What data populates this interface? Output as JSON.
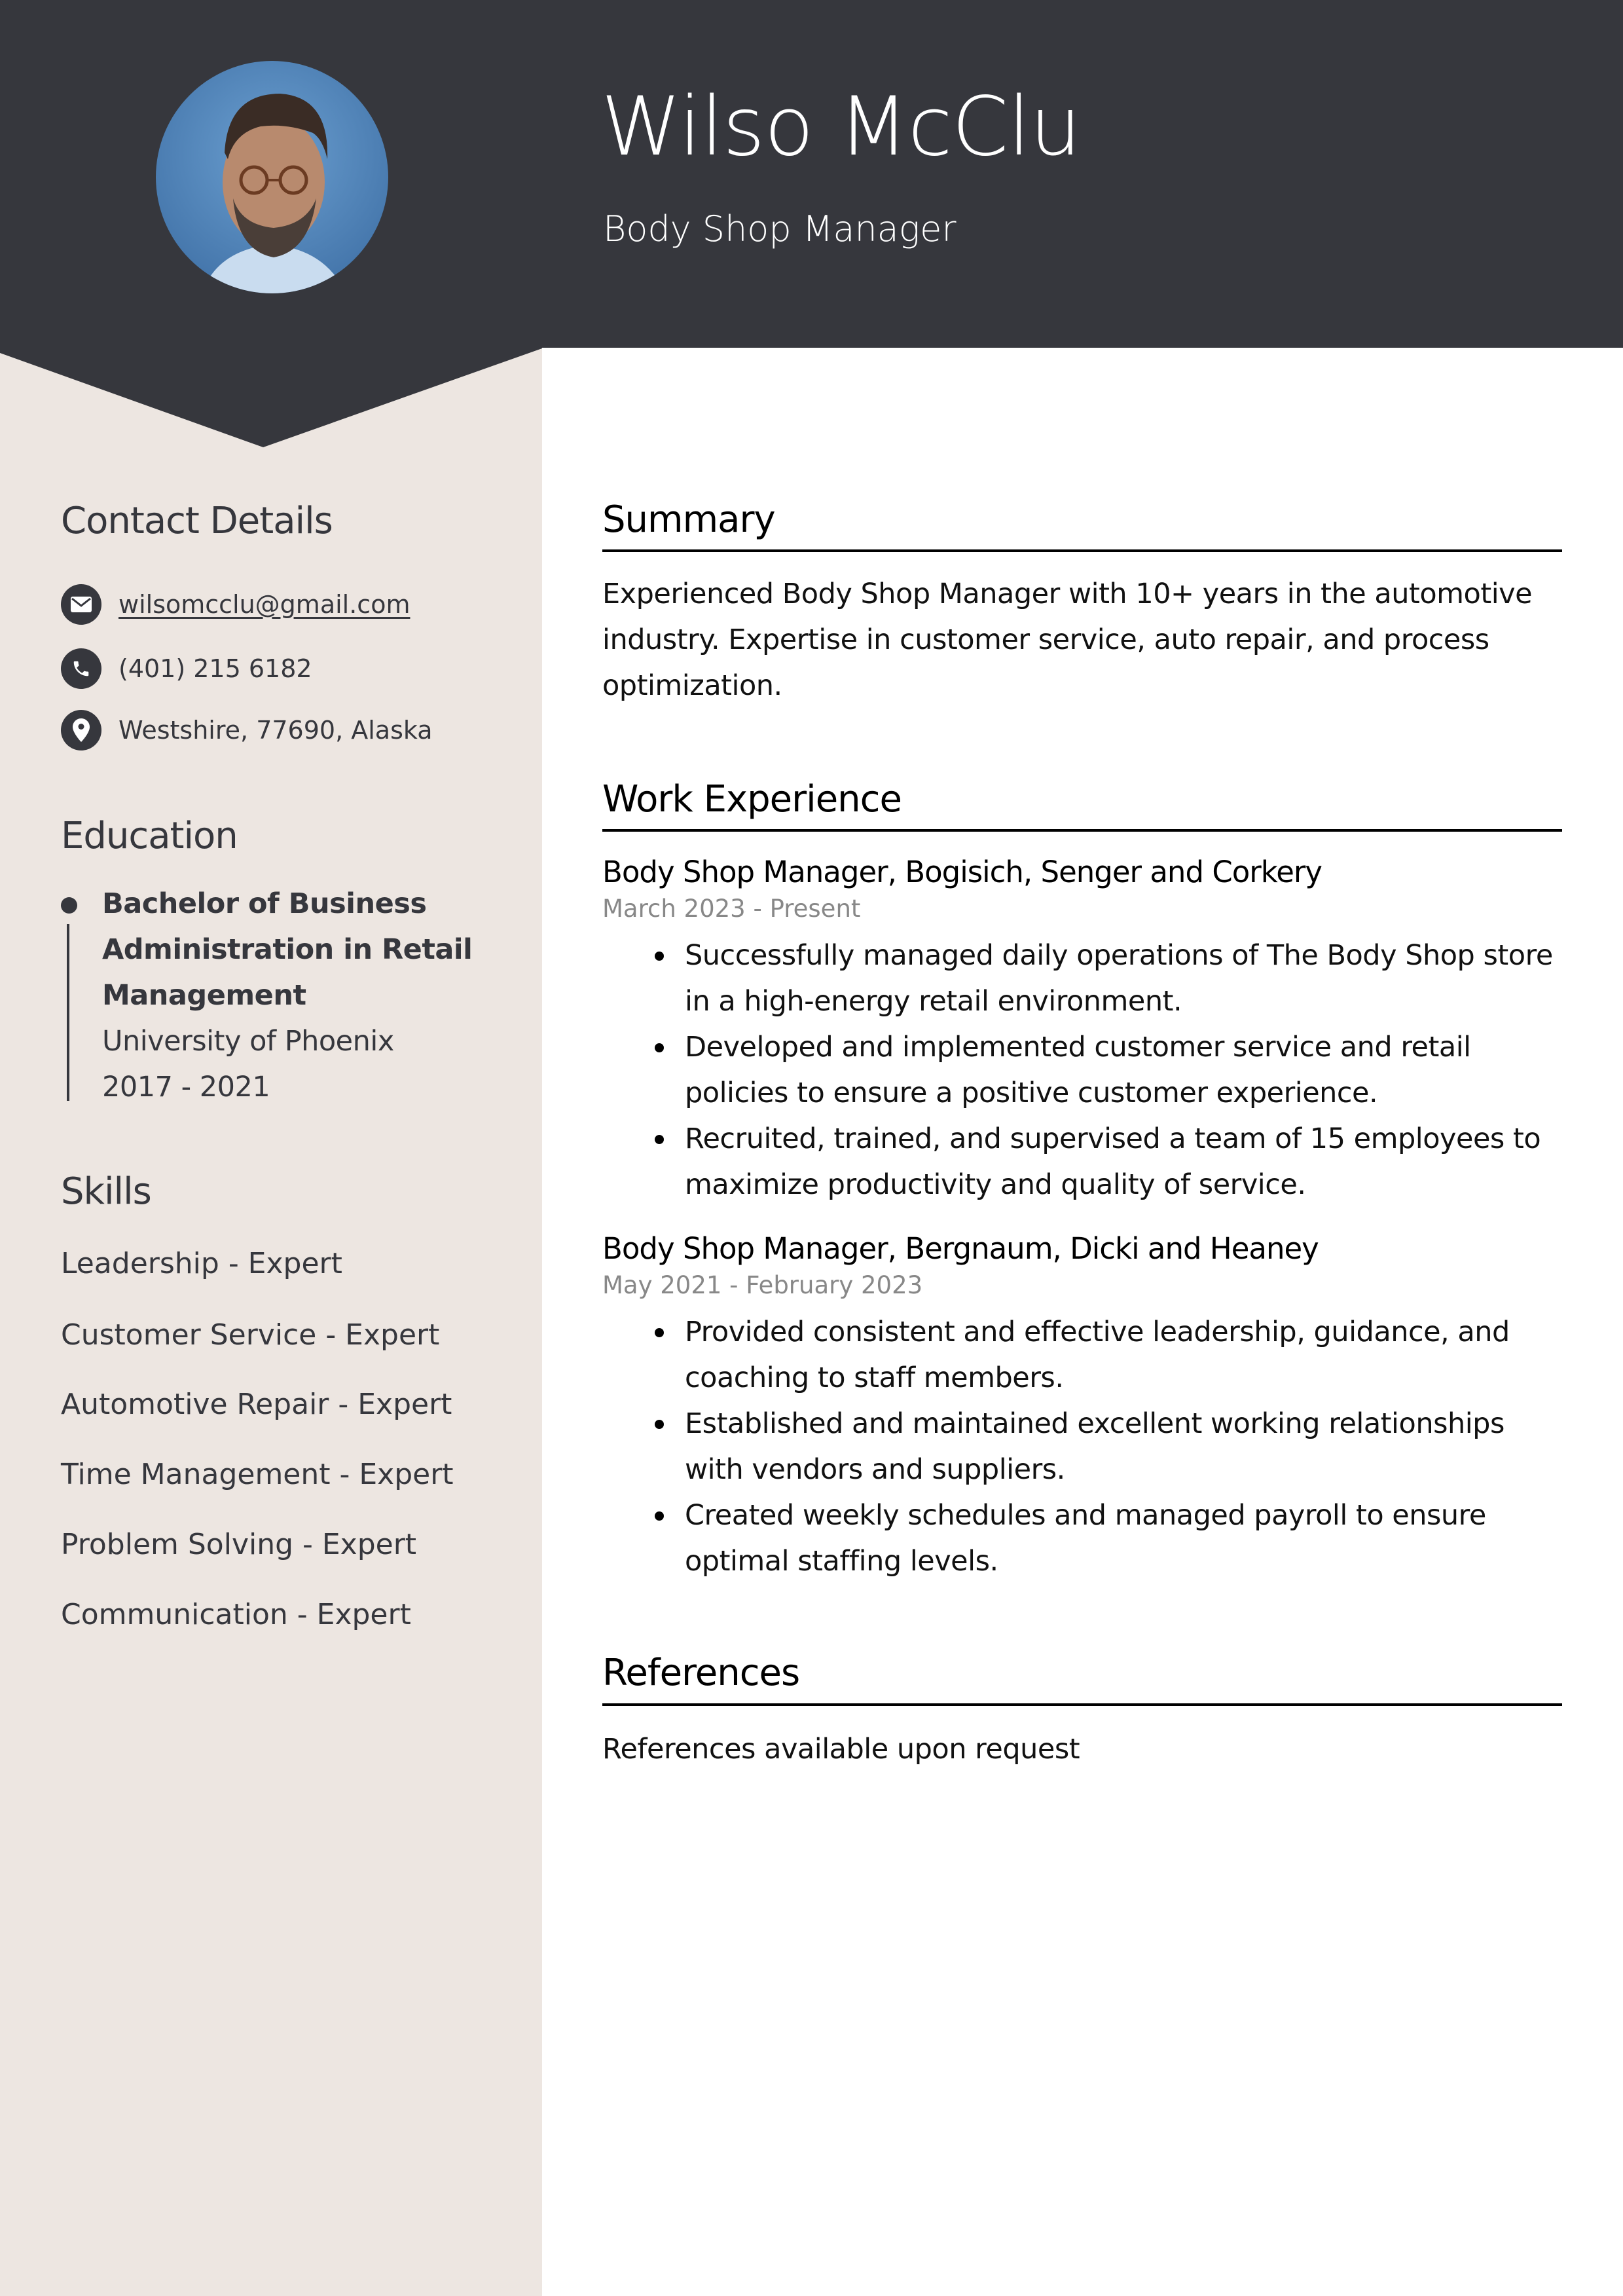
{
  "header": {
    "name": "Wilso McClu",
    "job_title": "Body Shop Manager",
    "photo_alt": "profile-photo"
  },
  "colors": {
    "header_bg": "#36373d",
    "sidebar_bg": "#ede6e1",
    "date_gray": "#888888"
  },
  "sidebar": {
    "contact": {
      "heading": "Contact Details",
      "items": [
        {
          "icon": "envelope-icon",
          "text": "wilsomcclu@gmail.com"
        },
        {
          "icon": "phone-icon",
          "text": "(401) 215 6182"
        },
        {
          "icon": "location-pin-icon",
          "text": "Westshire, 77690, Alaska"
        }
      ]
    },
    "education": {
      "heading": "Education",
      "degree": "Bachelor of Business Administration in Retail Management",
      "school": "University of Phoenix",
      "years": "2017 - 2021"
    },
    "skills": {
      "heading": "Skills",
      "items": [
        "Leadership - Expert",
        "Customer Service - Expert",
        "Automotive Repair - Expert",
        "Time Management - Expert",
        "Problem Solving - Expert",
        "Communication - Expert"
      ]
    }
  },
  "main": {
    "summary": {
      "heading": "Summary",
      "text": "Experienced Body Shop Manager with 10+ years in the automotive industry. Expertise in customer service, auto repair, and process optimization."
    },
    "work": {
      "heading": "Work Experience",
      "jobs": [
        {
          "title": "Body Shop Manager, Bogisich, Senger and Corkery",
          "dates": "March 2023 - Present",
          "bullets": [
            "Successfully managed daily operations of The Body Shop store in a high-energy retail environment.",
            "Developed and implemented customer service and retail policies to ensure a positive customer experience.",
            "Recruited, trained, and supervised a team of 15 employees to maximize productivity and quality of service."
          ]
        },
        {
          "title": "Body Shop Manager, Bergnaum, Dicki and Heaney",
          "dates": "May 2021 - February 2023",
          "bullets": [
            "Provided consistent and effective leadership, guidance, and coaching to staff members.",
            "Established and maintained excellent working relationships with vendors and suppliers.",
            "Created weekly schedules and managed payroll to ensure optimal staffing levels."
          ]
        }
      ]
    },
    "references": {
      "heading": "References",
      "text": "References available upon request"
    }
  }
}
